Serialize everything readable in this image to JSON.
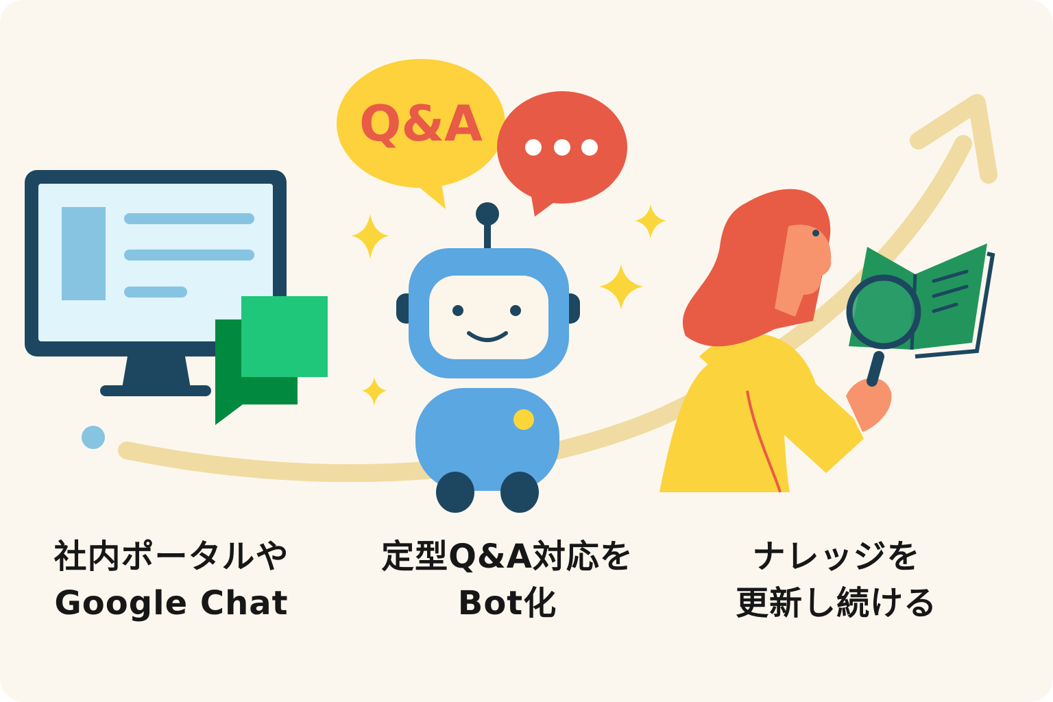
{
  "background_color": "#fcf7ee",
  "steps": [
    {
      "line1": "社内ポータルや",
      "line2": "Google Chat",
      "icons": [
        "monitor-icon",
        "chat-bubble-icon"
      ]
    },
    {
      "line1": "定型Q&A対応を",
      "line2": "Bot化",
      "icons": [
        "robot-icon",
        "qa-bubble-icon",
        "ellipsis-bubble-icon",
        "sparkle-icon"
      ]
    },
    {
      "line1": "ナレッジを",
      "line2": "更新し続ける",
      "icons": [
        "person-icon",
        "book-icon",
        "magnifier-icon"
      ]
    }
  ],
  "qa_bubble_text": "Q&A",
  "colors": {
    "navy": "#1d4760",
    "screen": "#dff4fb",
    "screen_block": "#86c4e1",
    "chat_light": "#1fc77a",
    "chat_dark": "#00893f",
    "robot_blue": "#5aa7e2",
    "robot_face": "#fcf5ea",
    "qa_yellow": "#fdd23c",
    "qa_text": "#e85b46",
    "bubble_red": "#e75a45",
    "sparkle": "#fbd63a",
    "arrow": "#f0dba2",
    "hair": "#e85c45",
    "skin": "#f7946d",
    "sweater": "#fbd33c",
    "book_green": "#22955c",
    "text": "#171717"
  }
}
